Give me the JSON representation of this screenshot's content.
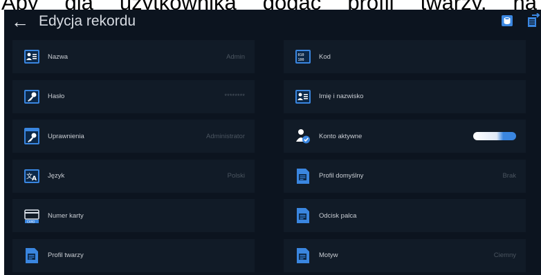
{
  "doc_text_top": [
    "Aby",
    "dla",
    "użytkownika",
    "dodać",
    "profil",
    "twarzy,",
    "na"
  ],
  "header": {
    "title": "Edycja rekordu"
  },
  "fields_left": [
    {
      "label": "Nazwa",
      "value": "Admin",
      "icon": "user-id-card-icon"
    },
    {
      "label": "Hasło",
      "value": "********",
      "icon": "key-icon"
    },
    {
      "label": "Uprawnienia",
      "value": "Administrator",
      "icon": "key-permissions-icon"
    },
    {
      "label": "Język",
      "value": "Polski",
      "icon": "translate-icon"
    },
    {
      "label": "Numer karty",
      "value": "",
      "icon": "card-icon"
    },
    {
      "label": "Profil twarzy",
      "value": "",
      "icon": "document-icon"
    }
  ],
  "fields_right": [
    {
      "label": "Kod",
      "value": "",
      "icon": "barcode-icon"
    },
    {
      "label": "Imię i nazwisko",
      "value": "",
      "icon": "user-id-card-icon"
    },
    {
      "label": "Konto aktywne",
      "value": "",
      "icon": "user-check-icon",
      "toggle_on": true
    },
    {
      "label": "Profil domyślny",
      "value": "Brak",
      "icon": "document-icon"
    },
    {
      "label": "Odcisk palca",
      "value": "",
      "icon": "document-icon"
    },
    {
      "label": "Motyw",
      "value": "Ciemny",
      "icon": "document-icon"
    }
  ],
  "colors": {
    "background": "#0c141f",
    "row": "#111b27",
    "accent": "#3a86e0",
    "label": "#c9cdd3"
  }
}
